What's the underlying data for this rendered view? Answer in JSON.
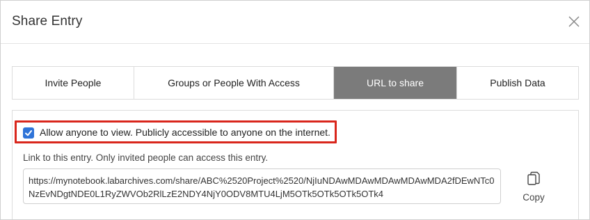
{
  "dialog": {
    "title": "Share Entry",
    "close_icon": "close-icon"
  },
  "tabs": [
    {
      "label": "Invite People",
      "active": false
    },
    {
      "label": "Groups or People With Access",
      "active": false
    },
    {
      "label": "URL to share",
      "active": true
    },
    {
      "label": "Publish Data",
      "active": false
    }
  ],
  "url_share": {
    "allow_checked": true,
    "allow_label": "Allow anyone to view. Publicly accessible to anyone on the internet.",
    "link_description": "Link to this entry. Only invited people can access this entry.",
    "url": "https://mynotebook.labarchives.com/share/ABC%2520Project%2520/NjIuNDAwMDAwMDAwMDAwMDA2fDEwNTc0NzEvNDgtNDE0L1RyZWVOb2RlLzE2NDY4NjY0ODV8MTU4LjM5OTk5OTk5OTk5OTk4",
    "copy_label": "Copy",
    "copy_icon": "copy-icon"
  },
  "colors": {
    "active_tab_bg": "#7b7b7b",
    "highlight_border": "#d9261c",
    "checkbox": "#2f74d8"
  }
}
